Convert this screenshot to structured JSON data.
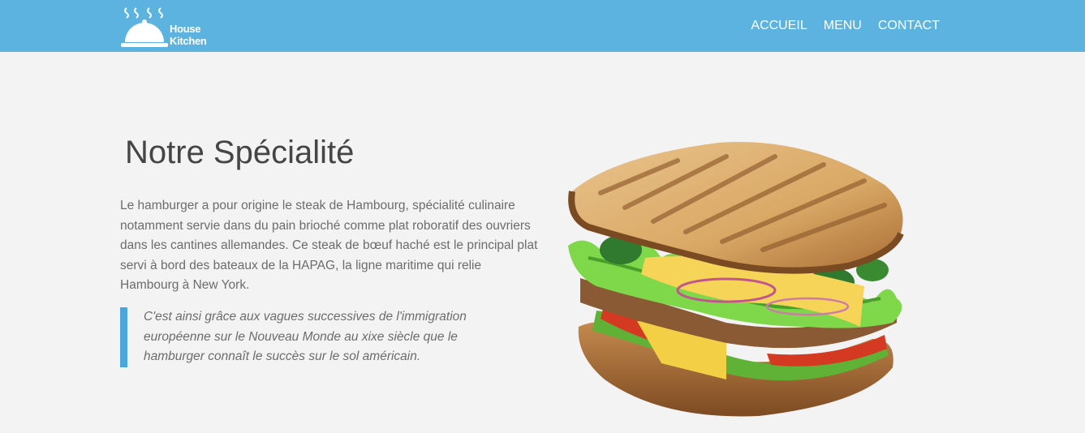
{
  "header": {
    "brand_line1": "House",
    "brand_line2": "Kitchen",
    "logo_icon": "cloche-icon",
    "nav": [
      {
        "label": "ACCUEIL"
      },
      {
        "label": "MENU"
      },
      {
        "label": "CONTACT"
      }
    ],
    "bg_color": "#5db3e0"
  },
  "main": {
    "title": "Notre Spécialité",
    "intro": "Le hamburger a pour origine le steak de Hambourg, spécialité culinaire notamment servie dans du pain brioché comme plat roboratif des ouvriers dans les cantines allemandes. Ce steak de bœuf haché est le principal plat servi à bord des bateaux de la HAPAG, la ligne maritime qui relie Hambourg à New York.",
    "quote": "C'est ainsi grâce aux vagues successives de l'immigration européenne sur le Nouveau Monde au xixe siècle que le hamburger connaît le succès sur le sol américain.",
    "accent_color": "#4aa6dc",
    "image_subject": "sandwich-image"
  }
}
